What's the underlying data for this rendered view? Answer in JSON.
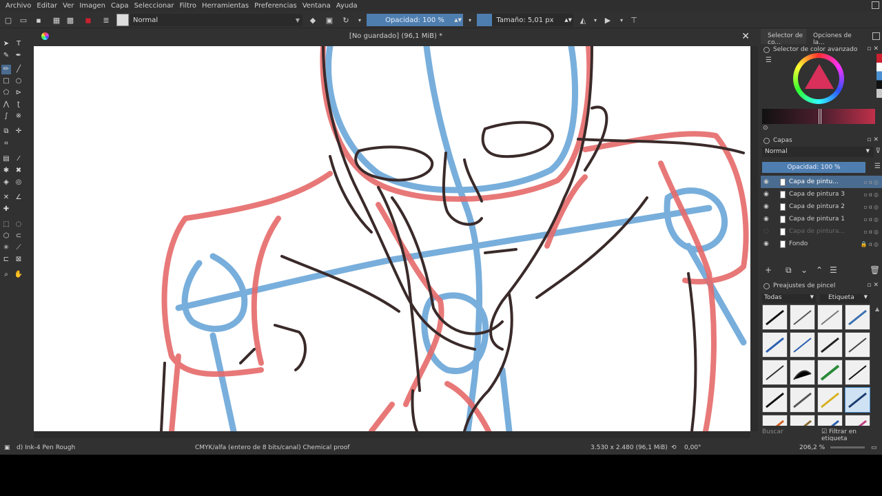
{
  "menu": [
    "Archivo",
    "Editar",
    "Ver",
    "Imagen",
    "Capa",
    "Seleccionar",
    "Filtro",
    "Herramientas",
    "Preferencias",
    "Ventana",
    "Ayuda"
  ],
  "toolbar": {
    "blend_mode": "Normal",
    "opacity_label": "Opacidad: 100 %",
    "size_label": "Tamaño: 5,01 px"
  },
  "document": {
    "title": "[No guardado] (96,1 MiB) *",
    "close_glyph": "✕"
  },
  "dock": {
    "tabs": [
      "Selector de co...",
      "Opciones de la..."
    ]
  },
  "color_panel": {
    "title": "Selector de color avanzado",
    "colors": {
      "foreground": "#cc2030",
      "background": "#ffffff",
      "accent": "#4e7eb0"
    }
  },
  "layers_panel": {
    "title": "Capas",
    "blend_mode": "Normal",
    "opacity_label": "Opacidad: 100 %",
    "layers": [
      {
        "name": "Capa de pintu...",
        "state": "active"
      },
      {
        "name": "Capa de pintura 3",
        "state": "visible"
      },
      {
        "name": "Capa de pintura 2",
        "state": "visible"
      },
      {
        "name": "Capa de pintura 1",
        "state": "visible"
      },
      {
        "name": "Capa de pintura...",
        "state": "hidden"
      },
      {
        "name": "Fondo",
        "state": "locked"
      }
    ]
  },
  "brush_panel": {
    "title": "Preajustes de pincel",
    "tag_value": "Todas",
    "tag_label": "Etiqueta",
    "search_placeholder": "Buscar",
    "filter_label": "Filtrar en etiqueta"
  },
  "status": {
    "brush_name": "d) Ink-4 Pen Rough",
    "color_space": "CMYK/alfa (entero de 8 bits/canal)  Chemical proof",
    "image_size": "3.530 x 2.480 (96,1 MiB)",
    "rotation": "0,00°",
    "zoom": "206,2 %"
  }
}
